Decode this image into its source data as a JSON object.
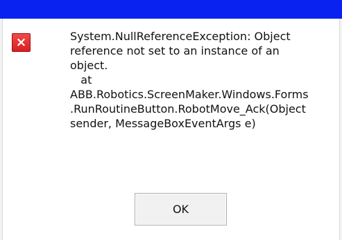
{
  "dialog": {
    "icon": {
      "name": "error-icon",
      "glyph": "×",
      "color": "#e02b2b"
    },
    "message_lines": [
      "System.NullReferenceException: Object",
      "reference not set to an instance of an",
      "object.",
      "   at",
      "ABB.Robotics.ScreenMaker.Windows.Forms",
      ".RunRoutineButton.RobotMove_Ack(Object",
      "sender, MessageBoxEventArgs e)"
    ],
    "ok_label": "OK"
  },
  "colors": {
    "title_bar": "#0a22f0",
    "background": "#ffffff",
    "button_face": "#f1f1f1"
  }
}
